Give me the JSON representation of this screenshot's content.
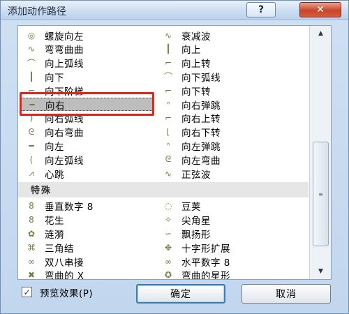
{
  "window": {
    "title": "添加动作路径",
    "help_label": "?",
    "close_label": "✕"
  },
  "list": {
    "basic_rows": [
      {
        "left": {
          "label": "螺旋向左",
          "icon": "spiral-left-icon",
          "glyph": "◎"
        },
        "right": {
          "label": "衰减波",
          "icon": "decaying-wave-icon",
          "glyph": "∿"
        }
      },
      {
        "left": {
          "label": "弯弯曲曲",
          "icon": "curvy-icon",
          "glyph": "∿"
        },
        "right": {
          "label": "向上",
          "icon": "up-icon",
          "glyph": "┃"
        }
      },
      {
        "left": {
          "label": "向上弧线",
          "icon": "arc-up-icon",
          "glyph": "⌒"
        },
        "right": {
          "label": "向上转",
          "icon": "turn-up-icon",
          "glyph": "⌐"
        }
      },
      {
        "left": {
          "label": "向下",
          "icon": "down-icon",
          "glyph": "┃"
        },
        "right": {
          "label": "向下弧线",
          "icon": "arc-down-icon",
          "glyph": "⌒"
        }
      },
      {
        "left": {
          "label": "向下阶梯",
          "icon": "stairs-down-icon",
          "glyph": "⌐"
        },
        "right": {
          "label": "向下转",
          "icon": "turn-down-icon",
          "glyph": "⌐"
        }
      },
      {
        "left": {
          "label": "向右",
          "icon": "right-icon",
          "glyph": "━"
        },
        "right": {
          "label": "向右弹跳",
          "icon": "bounce-right-icon",
          "glyph": "ᐢ"
        }
      },
      {
        "left": {
          "label": "向右弧线",
          "icon": "arc-right-icon",
          "glyph": ")"
        },
        "right": {
          "label": "向右上转",
          "icon": "turn-up-right-icon",
          "glyph": "⌐"
        }
      },
      {
        "left": {
          "label": "向右弯曲",
          "icon": "curve-right-icon",
          "glyph": "ᘓ"
        },
        "right": {
          "label": "向右下转",
          "icon": "turn-down-right-icon",
          "glyph": "⌊"
        }
      },
      {
        "left": {
          "label": "向左",
          "icon": "left-icon",
          "glyph": "━"
        },
        "right": {
          "label": "向左弹跳",
          "icon": "bounce-left-icon",
          "glyph": "ᐢ"
        }
      },
      {
        "left": {
          "label": "向左弧线",
          "icon": "arc-left-icon",
          "glyph": "("
        },
        "right": {
          "label": "向左弯曲",
          "icon": "curve-left-icon",
          "glyph": "ᘓ"
        }
      },
      {
        "left": {
          "label": "心跳",
          "icon": "heartbeat-icon",
          "glyph": "⩘"
        },
        "right": {
          "label": "正弦波",
          "icon": "sine-wave-icon",
          "glyph": "∿"
        }
      }
    ],
    "section_header": "特殊",
    "special_rows": [
      {
        "left": {
          "label": "垂直数字 8",
          "icon": "vertical-figure-8-icon",
          "glyph": "8"
        },
        "right": {
          "label": "豆荚",
          "icon": "bean-icon",
          "glyph": "◌"
        }
      },
      {
        "left": {
          "label": "花生",
          "icon": "peanut-icon",
          "glyph": "8"
        },
        "right": {
          "label": "尖角星",
          "icon": "pointed-star-icon",
          "glyph": "✧"
        }
      },
      {
        "left": {
          "label": "涟漪",
          "icon": "ripple-icon",
          "glyph": "✿"
        },
        "right": {
          "label": "飘扬形",
          "icon": "swoosh-icon",
          "glyph": "∽"
        }
      },
      {
        "left": {
          "label": "三角结",
          "icon": "triangle-knot-icon",
          "glyph": "⌘"
        },
        "right": {
          "label": "十字形扩展",
          "icon": "cross-expand-icon",
          "glyph": "✥"
        }
      },
      {
        "left": {
          "label": "双八串接",
          "icon": "double-eight-icon",
          "glyph": "∞"
        },
        "right": {
          "label": "水平数字 8",
          "icon": "horizontal-figure-8-icon",
          "glyph": "∞"
        }
      },
      {
        "left": {
          "label": "弯曲的 X",
          "icon": "curvy-x-icon",
          "glyph": "✖"
        },
        "right": {
          "label": "弯曲的星形",
          "icon": "curvy-star-icon",
          "glyph": "✪"
        }
      }
    ],
    "selected_label": "向右"
  },
  "footer": {
    "preview_checked": "✓",
    "preview_label": "预览效果(P)",
    "ok_label": "确定",
    "cancel_label": "取消"
  },
  "colors": {
    "selection_box": "#e0261b",
    "icon_green": "#6a7f3c"
  }
}
